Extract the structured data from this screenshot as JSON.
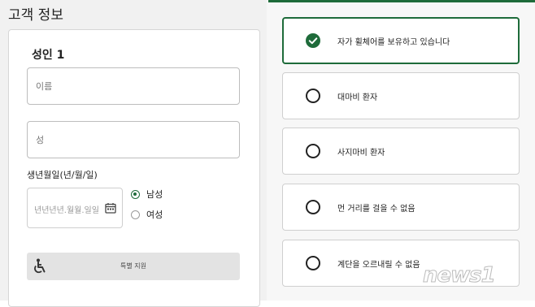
{
  "section_title": "고객 정보",
  "passenger": {
    "heading": "성인 1",
    "first_name_placeholder": "이름",
    "last_name_placeholder": "성",
    "dob_label": "생년월일(년/월/일)",
    "dob_placeholder": "년년년년.월월.일일",
    "gender_options": [
      {
        "label": "남성",
        "selected": true
      },
      {
        "label": "여성",
        "selected": false
      }
    ],
    "special_support_label": "특별 지원"
  },
  "assistance_options": [
    {
      "label": "자가 휠체어를 보유하고 있습니다",
      "selected": true
    },
    {
      "label": "대마비 환자",
      "selected": false
    },
    {
      "label": "사지마비 환자",
      "selected": false
    },
    {
      "label": "먼 거리를 걸을 수 없음",
      "selected": false
    },
    {
      "label": "계단을 오르내릴 수 없음",
      "selected": false
    }
  ],
  "watermark": "news1",
  "colors": {
    "accent": "#1e6b3a",
    "border": "#cfcfcf",
    "support_bar": "#e3e3e3"
  },
  "icons": [
    "calendar-icon",
    "wheelchair-icon",
    "check-circle-icon",
    "radio-icon"
  ]
}
